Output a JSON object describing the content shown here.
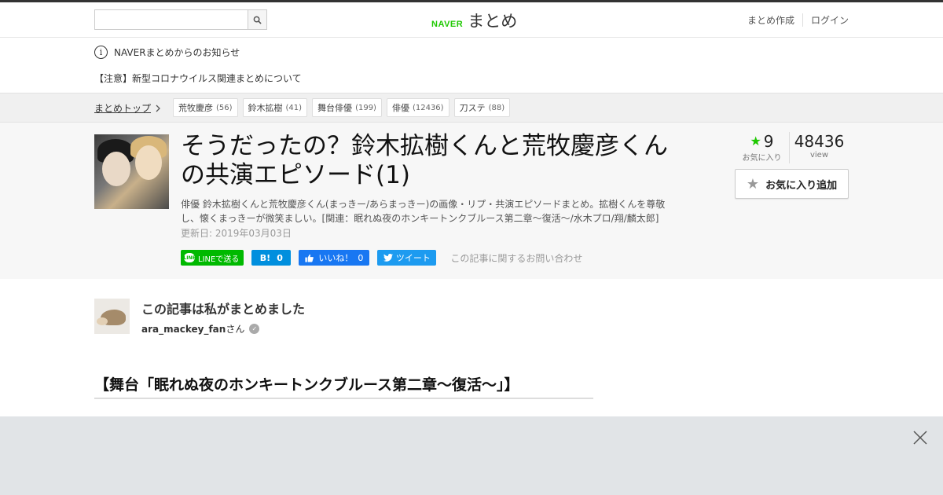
{
  "header": {
    "search_placeholder": "",
    "logo_brand": "NAVER",
    "logo_service": "まとめ",
    "links": [
      "まとめ作成",
      "ログイン"
    ]
  },
  "notice": {
    "title": "NAVERまとめからのお知らせ",
    "item": "【注意】新型コロナウイルス関連まとめについて"
  },
  "breadcrumb": {
    "top_label": "まとめトップ",
    "tags": [
      {
        "label": "荒牧慶彦",
        "count": "(56)"
      },
      {
        "label": "鈴木拡樹",
        "count": "(41)"
      },
      {
        "label": "舞台俳優",
        "count": "(199)"
      },
      {
        "label": "俳優",
        "count": "(12436)"
      },
      {
        "label": "刀ステ",
        "count": "(88)"
      }
    ]
  },
  "article": {
    "title": "そうだったの？鈴木拡樹くんと荒牧慶彦くんの共演エピソード(1)",
    "description": "俳優 鈴木拡樹くんと荒牧慶彦くん(まっきー/あらまっきー)の画像・リプ・共演エピソードまとめ。拡樹くんを尊敬し、懐くまっきーが微笑ましい。[関連：眠れぬ夜のホンキートンクブルース第二章〜復活〜/水木プロ/翔/麟太郎]",
    "updated": "更新日: 2019年03月03日",
    "share": {
      "line": "LINEで送る",
      "line_icon_text": "LINE",
      "hatena_mark": "B!",
      "hatena_count": "0",
      "fb_label": "いいね！",
      "fb_count": "0",
      "tweet": "ツイート"
    },
    "contact": "この記事に関するお問い合わせ"
  },
  "stats": {
    "fav_count": "9",
    "fav_label": "お気に入り",
    "view_count": "48436",
    "view_label": "view",
    "fav_button": "お気に入り追加"
  },
  "author": {
    "heading": "この記事は私がまとめました",
    "name": "ara_mackey_fan",
    "suffix": "さん"
  },
  "section": {
    "heading": "【舞台「眠れぬ夜のホンキートンクブルース第二章〜復活〜」】"
  },
  "colors": {
    "brand_green": "#1ec800",
    "line_green": "#00b900",
    "hatena_blue": "#008fde",
    "facebook_blue": "#1877f2",
    "twitter_blue": "#1d9bf0"
  }
}
